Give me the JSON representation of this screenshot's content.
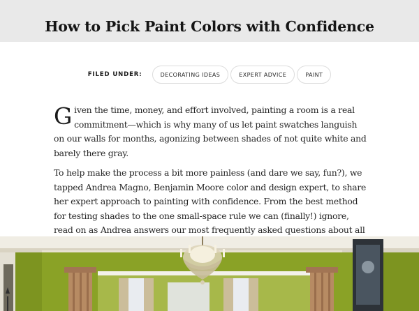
{
  "article": {
    "title": "How to Pick Paint Colors with Confidence",
    "filed_under_label": "FILED UNDER:",
    "tags": [
      "DECORATING IDEAS",
      "EXPERT ADVICE",
      "PAINT"
    ],
    "dropcap": "G",
    "paragraph1_rest": "iven the time, money, and effort involved, painting a room is a real commitment—which is why many of us let paint swatches languish on our walls for months, agonizing between shades of not quite white and barely there gray.",
    "paragraph2": "To help make the process a bit more painless (and dare we say, fun?), we tapped Andrea Magno, Benjamin Moore color and design expert, to share her expert approach to painting with confidence. From the best method for testing shades to the one small-space rule we can (finally!) ignore, read on as Andrea answers our most frequently asked questions about all things paint."
  },
  "hero_image": {
    "subject": "green-painted dining room with crystal chandelier, columns and curtained windows",
    "colors": {
      "wall_green": "#8fa829",
      "ceiling": "#f1eee6",
      "column": "#b48660",
      "chandelier": "#d8cfb4"
    }
  }
}
